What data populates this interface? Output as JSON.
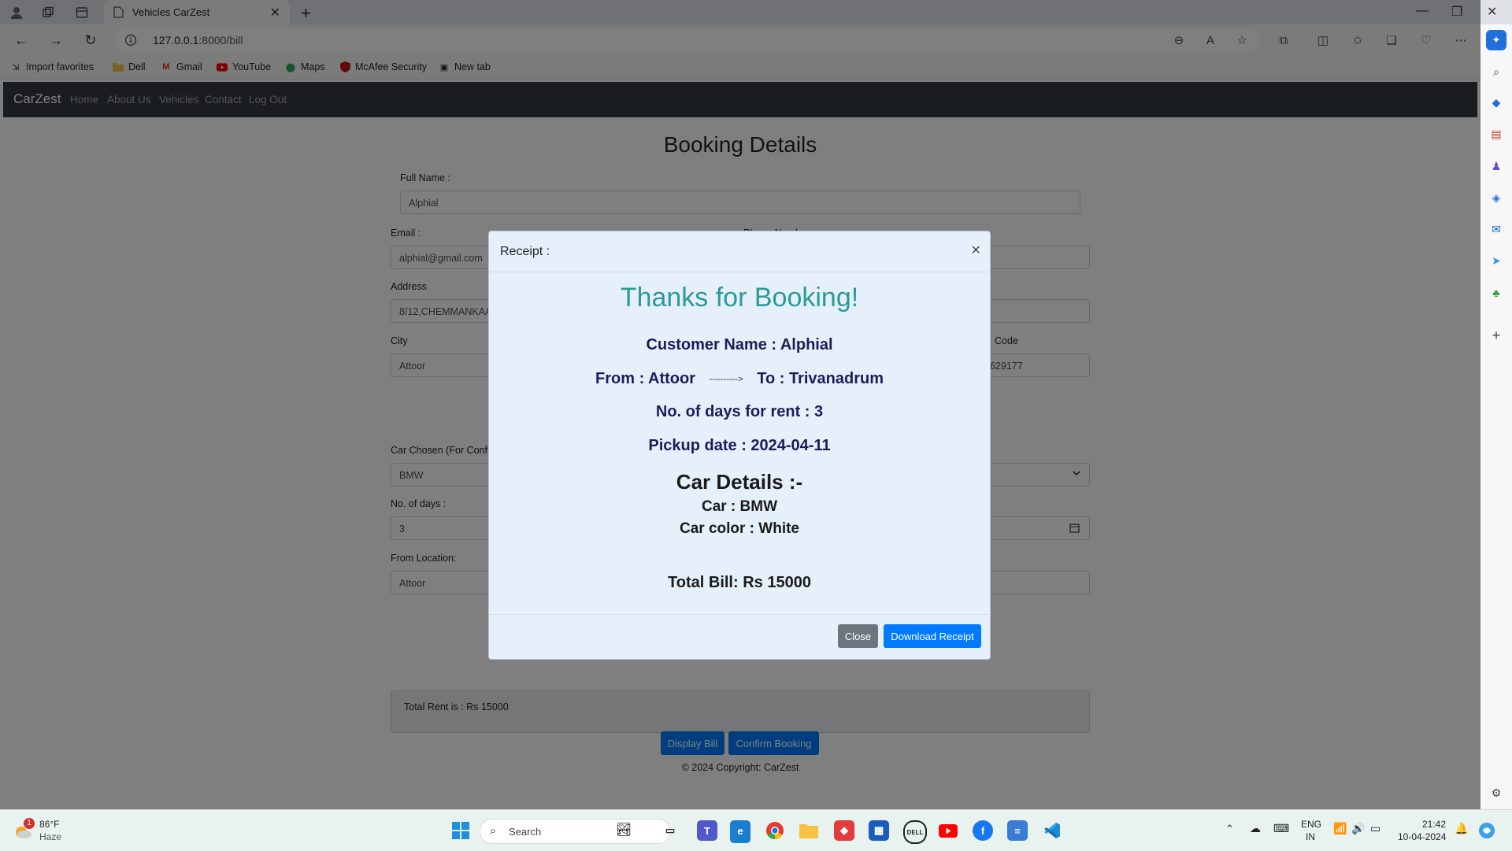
{
  "browser": {
    "tab_title": "Vehicles CarZest",
    "url_host": "127.0.0.1",
    "url_path": ":8000/bill",
    "bookmarks": [
      "Import favorites",
      "Dell",
      "Gmail",
      "YouTube",
      "Maps",
      "McAfee Security",
      "New tab"
    ]
  },
  "site": {
    "brand": "CarZest",
    "nav": [
      "Home",
      "About Us",
      "Vehicles",
      "Contact",
      "Log Out"
    ]
  },
  "form": {
    "heading": "Booking Details",
    "full_name_label": "Full Name :",
    "full_name": "Alphial",
    "email_label": "Email :",
    "email": "alphial@gmail.com",
    "phone_label_partial": "Phone Number",
    "address_label": "Address",
    "address": "8/12,CHEMMANKAA",
    "city_label": "City",
    "city": "Attoor",
    "pin_label_partial": "Code",
    "pin_partial": "629177",
    "car_label": "Car Chosen (For Confi",
    "car": "BMW",
    "days_label": "No. of days :",
    "days": "3",
    "from_label": "From Location:",
    "from": "Attoor",
    "total_rent": "Total Rent is : Rs 15000",
    "display_bill": "Display Bill",
    "confirm_booking": "Confirm Booking",
    "footer": "© 2024 Copyright: CarZest"
  },
  "modal": {
    "title": "Receipt :",
    "close_x": "×",
    "thanks": "Thanks for Booking!",
    "customer": "Customer Name : Alphial",
    "from": "From : Attoor",
    "arrow": "---------->",
    "to": "To : Trivanadrum",
    "days": "No. of days for rent : 3",
    "pickup": "Pickup date : 2024-04-11",
    "car_details_heading": "Car Details :-",
    "car": "Car : BMW",
    "color": "Car color : White",
    "total": "Total Bill: Rs 15000",
    "close_btn": "Close",
    "download_btn": "Download Receipt"
  },
  "taskbar": {
    "temp": "86°F",
    "weather": "Haze",
    "weather_badge": "1",
    "search_placeholder": "Search",
    "lang_1": "ENG",
    "lang_2": "IN",
    "time": "21:42",
    "date": "10-04-2024"
  },
  "colors": {
    "thanks": "#2b9a98",
    "modal_text": "#1f1a5a",
    "primary": "#007bff",
    "navbar": "#343a40"
  }
}
